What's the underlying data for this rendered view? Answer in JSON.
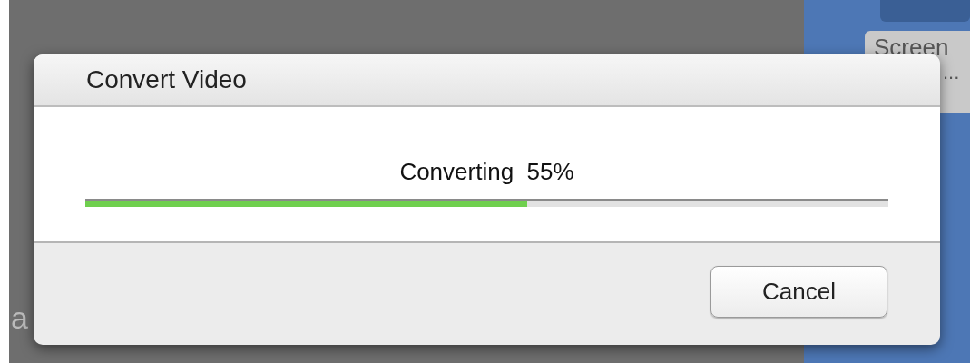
{
  "background": {
    "left_label": "a",
    "side_item": {
      "title": "Screen",
      "subtitle": "..."
    }
  },
  "dialog": {
    "title": "Convert Video",
    "status": "Converting  55%",
    "progress": {
      "level": 0.55
    },
    "buttons": [
      "Cancel"
    ]
  }
}
